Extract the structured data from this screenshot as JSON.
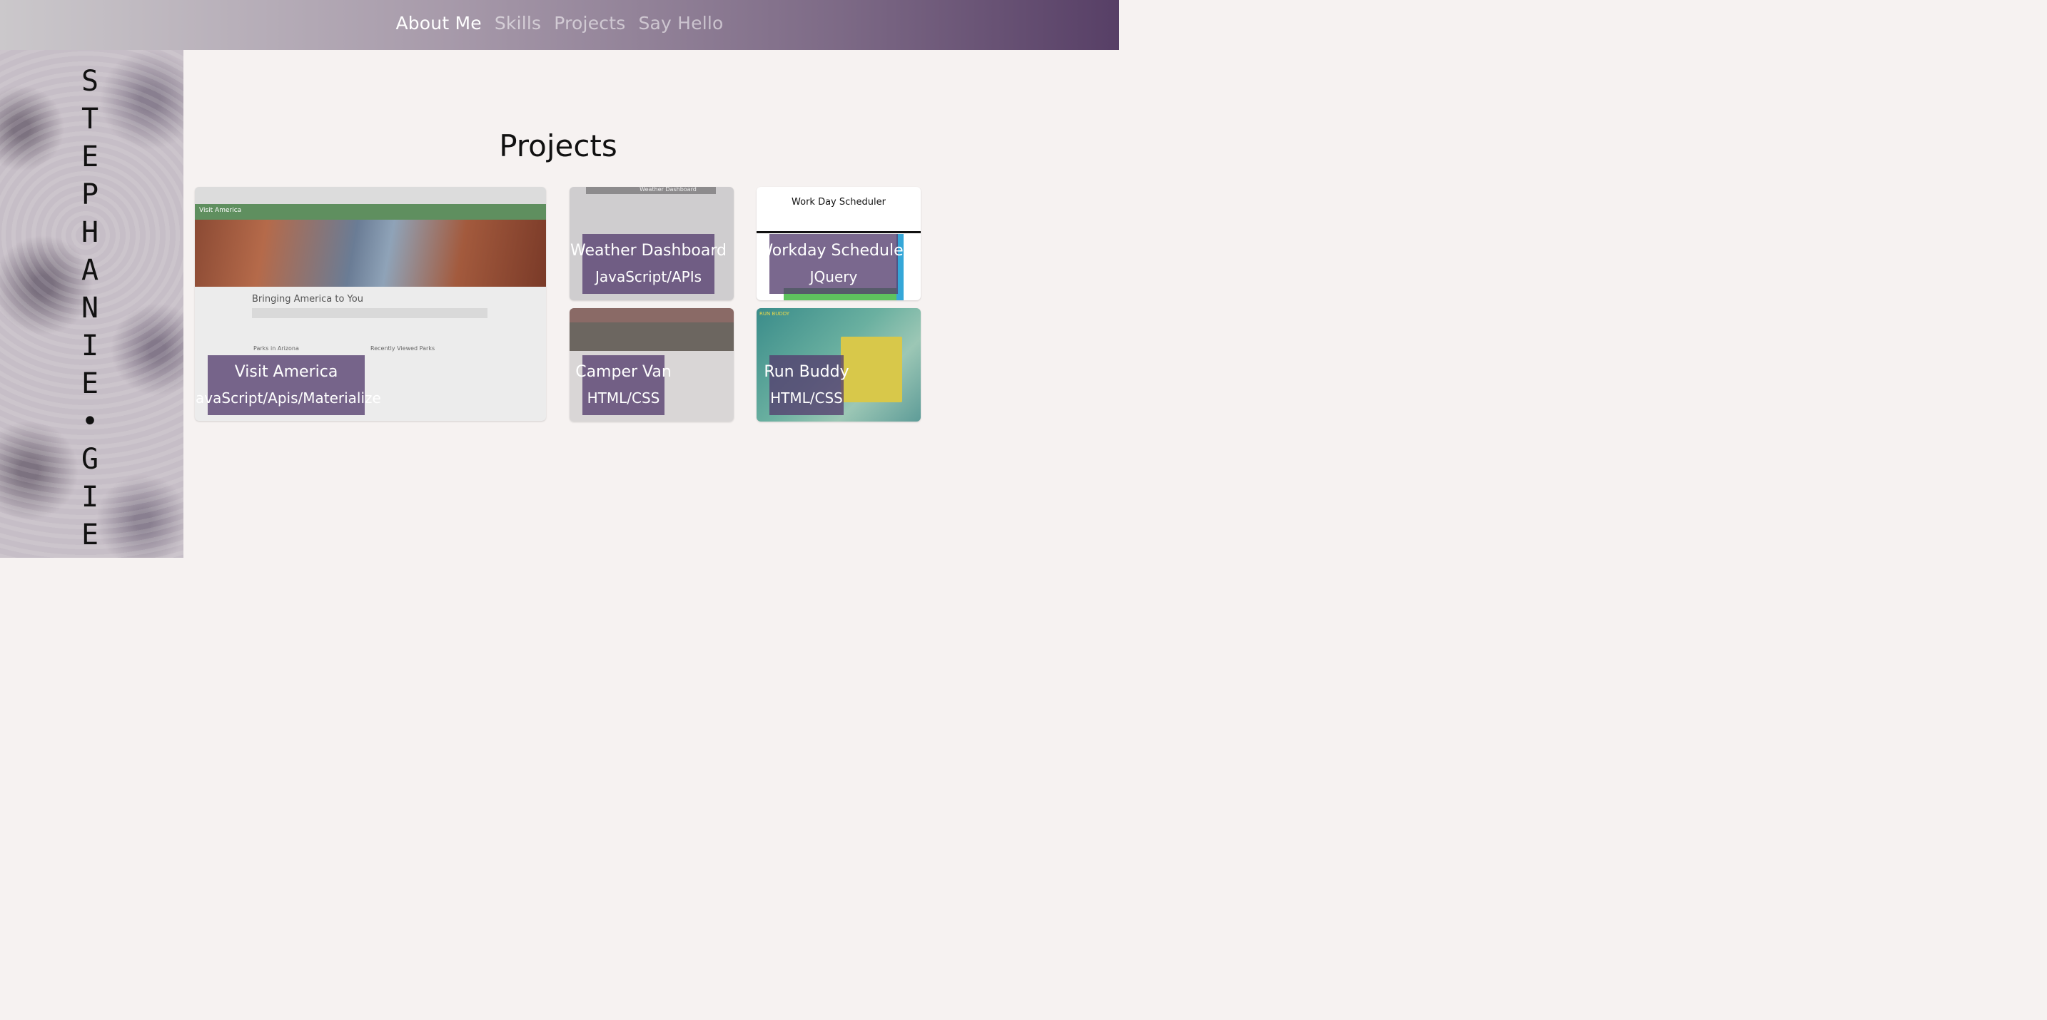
{
  "nav": {
    "items": [
      "About Me",
      "Skills",
      "Projects",
      "Say Hello"
    ],
    "active_index": 0
  },
  "sidebar": {
    "name_letters": [
      "S",
      "T",
      "E",
      "P",
      "H",
      "A",
      "N",
      "I",
      "E",
      "•",
      "G",
      "I",
      "E"
    ]
  },
  "projects": {
    "title": "Projects",
    "cards": [
      {
        "title": "Visit America",
        "tech": "JavaScript/Apis/Materialize",
        "thumb": {
          "bar_text": "Visit America",
          "heading": "Bringing America to You",
          "col_left": "Parks in Arizona",
          "col_right": "Recently Viewed Parks"
        }
      },
      {
        "title": "Weather Dashboard",
        "tech": "JavaScript/APIs",
        "thumb": {
          "header": "Weather Dashboard"
        }
      },
      {
        "title": "Workday Scheduler",
        "tech": "JQuery",
        "thumb": {
          "header": "Work Day Scheduler"
        }
      },
      {
        "title": "Camper Van",
        "tech": "HTML/CSS"
      },
      {
        "title": "Run Buddy",
        "tech": "HTML/CSS",
        "thumb": {
          "brand": "RUN BUDDY"
        }
      }
    ]
  },
  "colors": {
    "overlay": "#553e6e",
    "nav_end": "#573f66",
    "background": "#f6f2f1"
  }
}
